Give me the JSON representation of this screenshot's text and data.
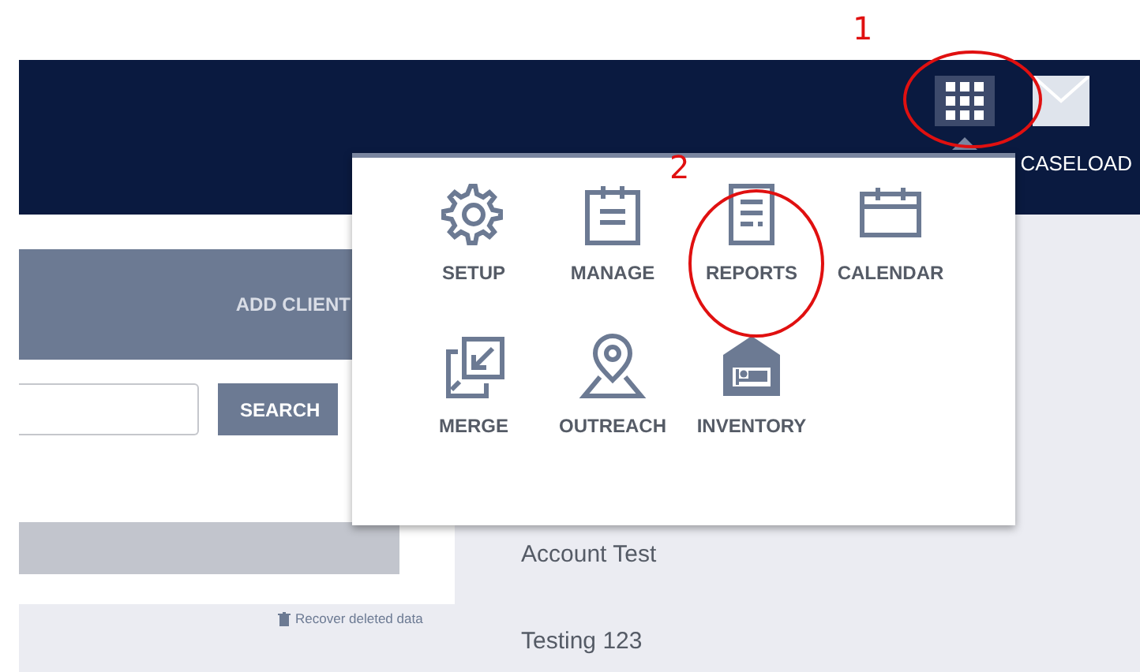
{
  "header": {
    "caseload_label": "CASELOAD"
  },
  "apps_menu": {
    "items": [
      {
        "label": "SETUP",
        "kind": "gear"
      },
      {
        "label": "MANAGE",
        "kind": "clipboard"
      },
      {
        "label": "REPORTS",
        "kind": "document"
      },
      {
        "label": "CALENDAR",
        "kind": "calendar"
      },
      {
        "label": "MERGE",
        "kind": "merge"
      },
      {
        "label": "OUTREACH",
        "kind": "pin"
      },
      {
        "label": "INVENTORY",
        "kind": "house"
      }
    ]
  },
  "client_panel": {
    "add_button": "ADD CLIENT",
    "search_button": "SEARCH",
    "recover_link": "Recover deleted data"
  },
  "clients": [
    "Account Test",
    "Testing 123"
  ],
  "annotations": [
    "1",
    "2"
  ]
}
